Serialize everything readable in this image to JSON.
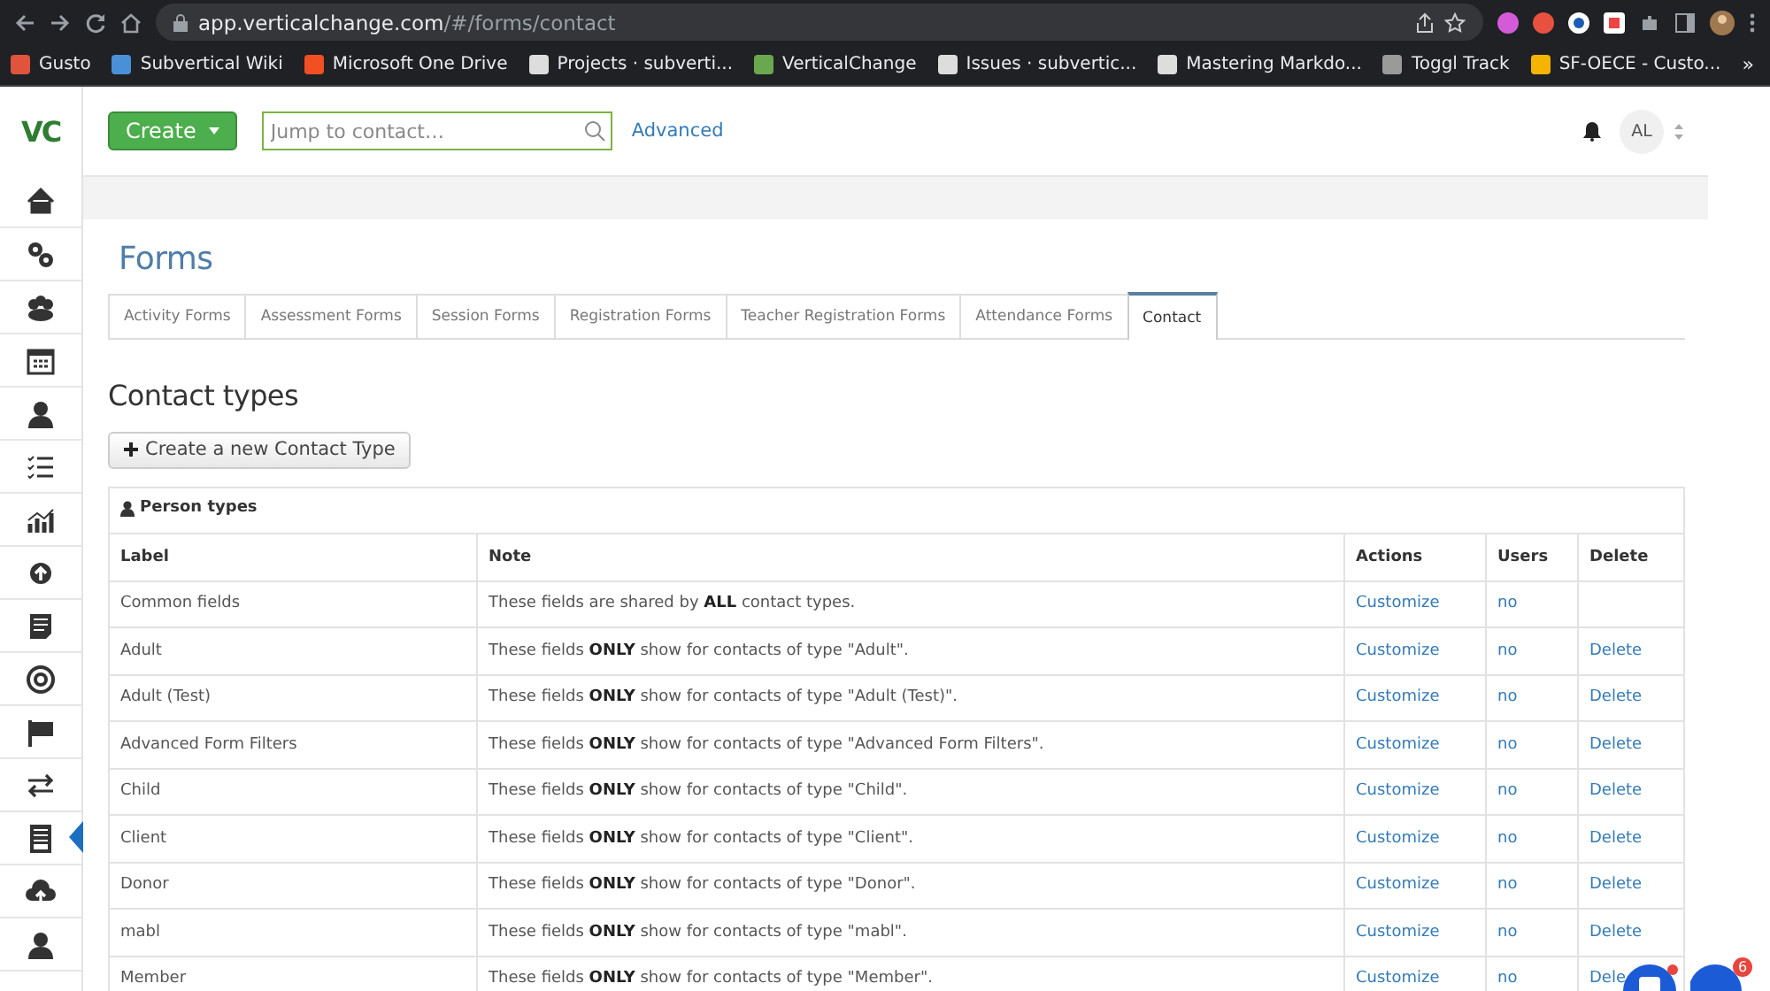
{
  "browser": {
    "url_host": "app.verticalchange.com",
    "url_path": "/#/forms/contact",
    "bookmarks": [
      {
        "label": "Gusto",
        "color": "#e0533d"
      },
      {
        "label": "Subvertical Wiki",
        "color": "#4a90d9"
      },
      {
        "label": "Microsoft One Drive",
        "color": "#f25022"
      },
      {
        "label": "Projects · subverti...",
        "color": "#dddddd"
      },
      {
        "label": "VerticalChange",
        "color": "#6aa84f"
      },
      {
        "label": "Issues · subvertic...",
        "color": "#dddddd"
      },
      {
        "label": "Mastering Markdo...",
        "color": "#dddddd"
      },
      {
        "label": "Toggl Track",
        "color": "#9a9a9a"
      },
      {
        "label": "SF-OECE - Custo...",
        "color": "#f4b400"
      }
    ],
    "more": "»"
  },
  "header": {
    "logo": "VC",
    "create_button": "Create",
    "search": {
      "placeholder": "Jump to contact…"
    },
    "advanced_link": "Advanced",
    "avatar": "AL"
  },
  "sidebar": {
    "items": [
      {
        "selected": false
      },
      {
        "selected": false
      },
      {
        "selected": false
      },
      {
        "selected": false
      },
      {
        "selected": false
      },
      {
        "selected": false
      },
      {
        "selected": false
      },
      {
        "selected": false
      },
      {
        "selected": false
      },
      {
        "selected": false
      },
      {
        "selected": false
      },
      {
        "selected": false
      },
      {
        "selected": true
      },
      {
        "selected": false
      },
      {
        "selected": false
      }
    ]
  },
  "page": {
    "title": "Forms",
    "tabs": [
      {
        "label": "Activity Forms",
        "selected": false
      },
      {
        "label": "Assessment Forms",
        "selected": false
      },
      {
        "label": "Session Forms",
        "selected": false
      },
      {
        "label": "Registration Forms",
        "selected": false
      },
      {
        "label": "Teacher Registration Forms",
        "selected": false
      },
      {
        "label": "Attendance Forms",
        "selected": false
      },
      {
        "label": "Contact",
        "selected": true
      }
    ],
    "section_title": "Contact types",
    "new_button": "Create a new Contact Type",
    "table": {
      "title": "Person types",
      "columns": [
        "Label",
        "Note",
        "Actions",
        "Users",
        "Delete"
      ],
      "rows": [
        {
          "label": "Common fields",
          "note": "These fields are shared by **ALL** contact types.",
          "action": "Customize",
          "users": "no"
        },
        {
          "label": "Adult",
          "note": "These fields **ONLY** show for contacts of type \"Adult\".",
          "action": "Customize",
          "users": "no",
          "delete": "Delete"
        },
        {
          "label": "Adult (Test)",
          "note": "These fields **ONLY** show for contacts of type \"Adult (Test)\".",
          "action": "Customize",
          "users": "no",
          "delete": "Delete"
        },
        {
          "label": "Advanced Form Filters",
          "note": "These fields **ONLY** show for contacts of type \"Advanced Form Filters\".",
          "action": "Customize",
          "users": "no",
          "delete": "Delete"
        },
        {
          "label": "Child",
          "note": "These fields **ONLY** show for contacts of type \"Child\".",
          "action": "Customize",
          "users": "no",
          "delete": "Delete"
        },
        {
          "label": "Client",
          "note": "These fields **ONLY** show for contacts of type \"Client\".",
          "action": "Customize",
          "users": "no",
          "delete": "Delete"
        },
        {
          "label": "Donor",
          "note": "These fields **ONLY** show for contacts of type \"Donor\".",
          "action": "Customize",
          "users": "no",
          "delete": "Delete"
        },
        {
          "label": "mabl",
          "note": "These fields **ONLY** show for contacts of type \"mabl\".",
          "action": "Customize",
          "users": "no",
          "delete": "Delete"
        },
        {
          "label": "Member",
          "note": "These fields **ONLY** show for contacts of type \"Member\".",
          "action": "Customize",
          "users": "no",
          "delete": "Dele"
        }
      ]
    }
  },
  "chat": {
    "badge": "6"
  }
}
